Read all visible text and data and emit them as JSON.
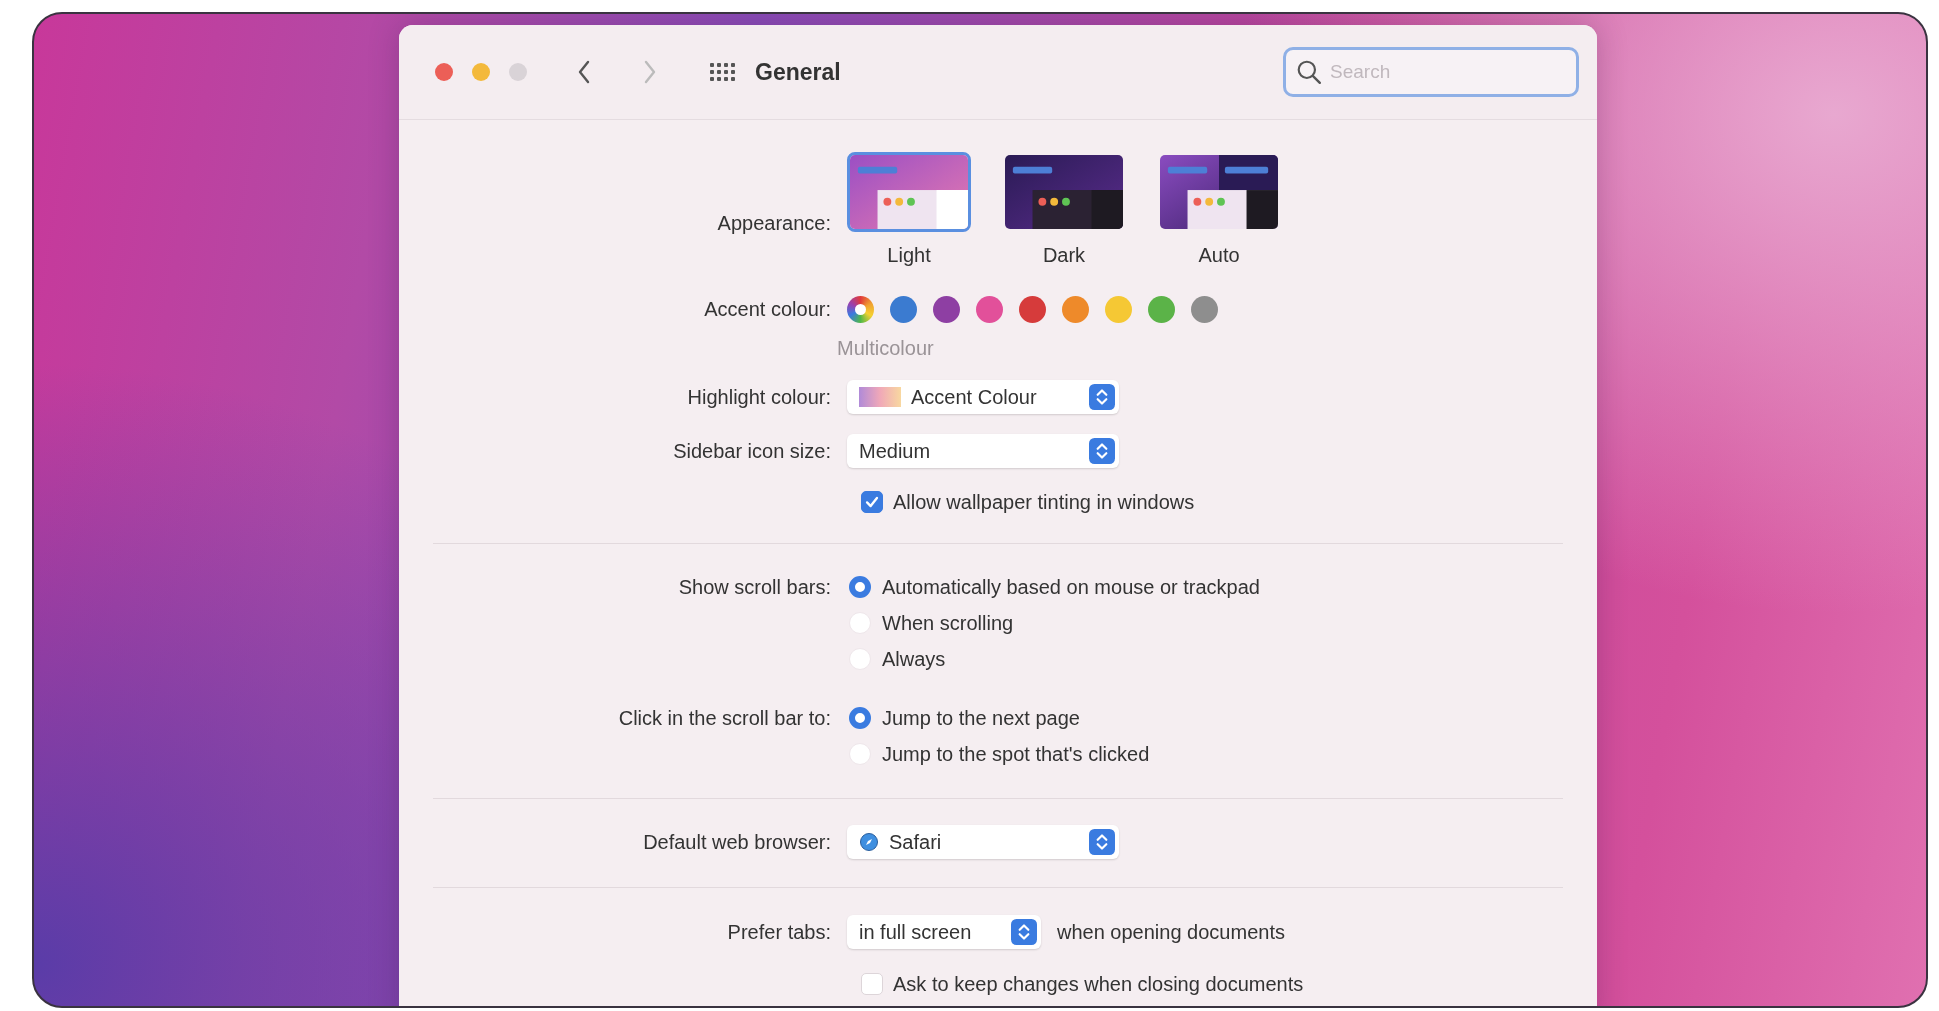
{
  "window": {
    "title": "General",
    "search": {
      "placeholder": "Search"
    }
  },
  "traffic_lights": [
    {
      "kind": "close",
      "disabled": false
    },
    {
      "kind": "minimize",
      "disabled": false
    },
    {
      "kind": "zoom",
      "disabled": true
    }
  ],
  "navigation": {
    "back_disabled": false,
    "forward_disabled": true
  },
  "appearance": {
    "label": "Appearance:",
    "options": [
      {
        "name": "Light",
        "kind": "light",
        "selected": true
      },
      {
        "name": "Dark",
        "kind": "dark",
        "selected": false
      },
      {
        "name": "Auto",
        "kind": "auto",
        "selected": false
      }
    ]
  },
  "accent": {
    "label": "Accent colour:",
    "caption": "Multicolour",
    "swatches": [
      {
        "kind": "multicolour",
        "selected": true
      },
      {
        "kind": "solid",
        "color": "#3b7bd0",
        "selected": false
      },
      {
        "kind": "solid",
        "color": "#8e3fa3",
        "selected": false
      },
      {
        "kind": "solid",
        "color": "#e2509a",
        "selected": false
      },
      {
        "kind": "solid",
        "color": "#d63b3b",
        "selected": false
      },
      {
        "kind": "solid",
        "color": "#ee8a2a",
        "selected": false
      },
      {
        "kind": "solid",
        "color": "#f5c834",
        "selected": false
      },
      {
        "kind": "solid",
        "color": "#5bb348",
        "selected": false
      },
      {
        "kind": "solid",
        "color": "#8e8e8e",
        "selected": false
      }
    ]
  },
  "highlight": {
    "label": "Highlight colour:",
    "value": "Accent Colour"
  },
  "sidebar_icon_size": {
    "label": "Sidebar icon size:",
    "value": "Medium"
  },
  "wallpaper_tinting": {
    "label": "Allow wallpaper tinting in windows",
    "checked": true
  },
  "scroll_bars": {
    "label": "Show scroll bars:",
    "options": [
      {
        "label": "Automatically based on mouse or trackpad",
        "selected": true
      },
      {
        "label": "When scrolling",
        "selected": false
      },
      {
        "label": "Always",
        "selected": false
      }
    ]
  },
  "click_scroll_bar": {
    "label": "Click in the scroll bar to:",
    "options": [
      {
        "label": "Jump to the next page",
        "selected": true
      },
      {
        "label": "Jump to the spot that's clicked",
        "selected": false
      }
    ]
  },
  "default_browser": {
    "label": "Default web browser:",
    "value": "Safari"
  },
  "prefer_tabs": {
    "label": "Prefer tabs:",
    "value": "in full screen",
    "suffix": "when opening documents"
  },
  "ask_keep_changes": {
    "label": "Ask to keep changes when closing documents",
    "checked": false
  }
}
